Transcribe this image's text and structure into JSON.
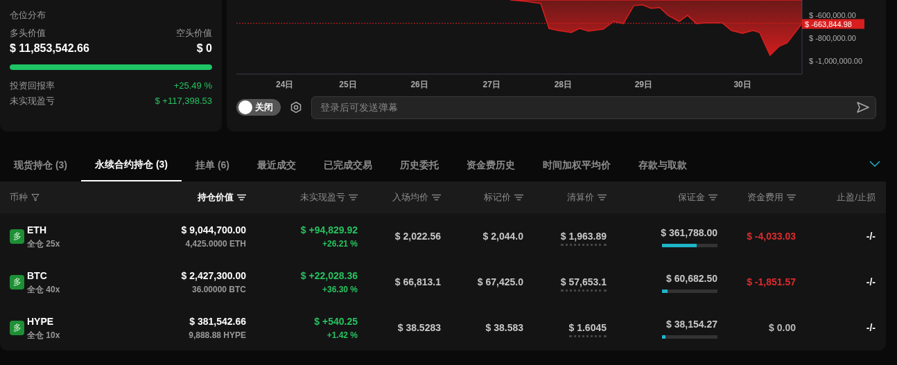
{
  "position_summary": {
    "title": "仓位分布",
    "long_label": "多头价值",
    "short_label": "空头价值",
    "long_value": "$ 11,853,542.66",
    "short_value": "$ 0",
    "long_share": {
      "level": 1.0
    },
    "stats": [
      {
        "label": "投资回报率",
        "value": "+25.49 %",
        "color": "#27c25f"
      },
      {
        "label": "未实现盈亏",
        "value": "$ +117,398.53",
        "color": "#27c25f"
      }
    ]
  },
  "chart_panel": {
    "chart_data": {
      "type": "area",
      "x": [
        26.98,
        27.2,
        27.39,
        27.5,
        27.62,
        27.8,
        27.91,
        28.03,
        28.23,
        28.37,
        28.5,
        28.64,
        28.76,
        28.87,
        28.99,
        29.1,
        29.25,
        29.36,
        29.48,
        29.59,
        29.83,
        29.95,
        30.1,
        30.24,
        30.33,
        30.47,
        30.59,
        30.7,
        30.85,
        30.9
      ],
      "series": [
        {
          "color": "#d81e1e",
          "values": [
            -460000,
            -473000,
            -490000,
            -709000,
            -727000,
            -745000,
            -709000,
            -733000,
            -715000,
            -648000,
            -667000,
            -509000,
            -503000,
            -533000,
            -527000,
            -594000,
            -648000,
            -594000,
            -667000,
            -661000,
            -661000,
            -727000,
            -752000,
            -727000,
            -745000,
            -945000,
            -867000,
            -836000,
            -709000,
            -664000
          ]
        }
      ],
      "xlim": [
        23.3,
        30.9
      ],
      "ylim": [
        -1109000,
        -460000
      ],
      "xticks": [
        {
          "value": 23.95,
          "label": "24日"
        },
        {
          "value": 24.8,
          "label": "25日"
        },
        {
          "value": 25.76,
          "label": "26日"
        },
        {
          "value": 26.73,
          "label": "27日"
        },
        {
          "value": 27.69,
          "label": "28日"
        },
        {
          "value": 28.77,
          "label": "29日"
        },
        {
          "value": 30.1,
          "label": "30日"
        }
      ],
      "yticks": [
        {
          "value": -600000,
          "label": "$ -600,000.00"
        },
        {
          "value": -800000,
          "label": "$ -800,000.00"
        },
        {
          "value": -1000000,
          "label": "$ -1,000,000.00"
        }
      ],
      "ref_lines": [
        {
          "axis": "y",
          "value": -663844.98,
          "label": "$ -663,844.98"
        }
      ]
    },
    "danmaku_toggle": {
      "on": false,
      "label": "关闭"
    },
    "message_input": {
      "placeholder": "登录后可发送弹幕"
    }
  },
  "tabs": [
    {
      "label": "现货持仓 (3)",
      "selected": false
    },
    {
      "label": "永续合约持仓 (3)",
      "selected": true
    },
    {
      "label": "挂单 (6)",
      "selected": false
    },
    {
      "label": "最近成交",
      "selected": false
    },
    {
      "label": "已完成交易",
      "selected": false
    },
    {
      "label": "历史委托",
      "selected": false
    },
    {
      "label": "资金费历史",
      "selected": false
    },
    {
      "label": "时间加权平均价",
      "selected": false
    },
    {
      "label": "存款与取款",
      "selected": false
    }
  ],
  "table": {
    "columns": [
      {
        "label": "币种",
        "kind": "filter",
        "active": false
      },
      {
        "label": "持仓价值",
        "kind": "sort",
        "active": true
      },
      {
        "label": "未实现盈亏",
        "kind": "sort",
        "active": false
      },
      {
        "label": "入场均价",
        "kind": "sort",
        "active": false
      },
      {
        "label": "标记价",
        "kind": "sort",
        "active": false
      },
      {
        "label": "清算价",
        "kind": "sort",
        "active": false
      },
      {
        "label": "保证金",
        "kind": "sort",
        "active": false
      },
      {
        "label": "资金费用",
        "kind": "sort",
        "active": false
      },
      {
        "label": "止盈/止损",
        "kind": "plain",
        "active": false
      }
    ],
    "rows": [
      {
        "side": "多",
        "coin": "ETH",
        "mode": "全仓 25x",
        "value": "$ 9,044,700.00",
        "size": "4,425.0000 ETH",
        "pnl": {
          "value": "$ +94,829.92",
          "percent": "+26.21 %",
          "color": "#27c25f"
        },
        "entry": "$ 2,022.56",
        "mark": "$ 2,044.0",
        "liq": "$ 1,963.89",
        "margin": "$ 361,788.00",
        "margin_level": {
          "level": 0.63
        },
        "funding": {
          "value": "$ -4,033.03",
          "color": "#e02b2b"
        },
        "tpsl": "-/-"
      },
      {
        "side": "多",
        "coin": "BTC",
        "mode": "全仓 40x",
        "value": "$ 2,427,300.00",
        "size": "36.00000 BTC",
        "pnl": {
          "value": "$ +22,028.36",
          "percent": "+36.30 %",
          "color": "#27c25f"
        },
        "entry": "$ 66,813.1",
        "mark": "$ 67,425.0",
        "liq": "$ 57,653.1",
        "margin": "$ 60,682.50",
        "margin_level": {
          "level": 0.1
        },
        "funding": {
          "value": "$ -1,851.57",
          "color": "#e02b2b"
        },
        "tpsl": "-/-"
      },
      {
        "side": "多",
        "coin": "HYPE",
        "mode": "全仓 10x",
        "value": "$ 381,542.66",
        "size": "9,888.88 HYPE",
        "pnl": {
          "value": "$ +540.25",
          "percent": "+1.42 %",
          "color": "#27c25f"
        },
        "entry": "$ 38.5283",
        "mark": "$ 38.583",
        "liq": "$ 1.6045",
        "margin": "$ 38,154.27",
        "margin_level": {
          "level": 0.06
        },
        "funding": {
          "value": "$ 0.00",
          "color": "#bbbbbb"
        },
        "tpsl": "-/-"
      }
    ]
  }
}
